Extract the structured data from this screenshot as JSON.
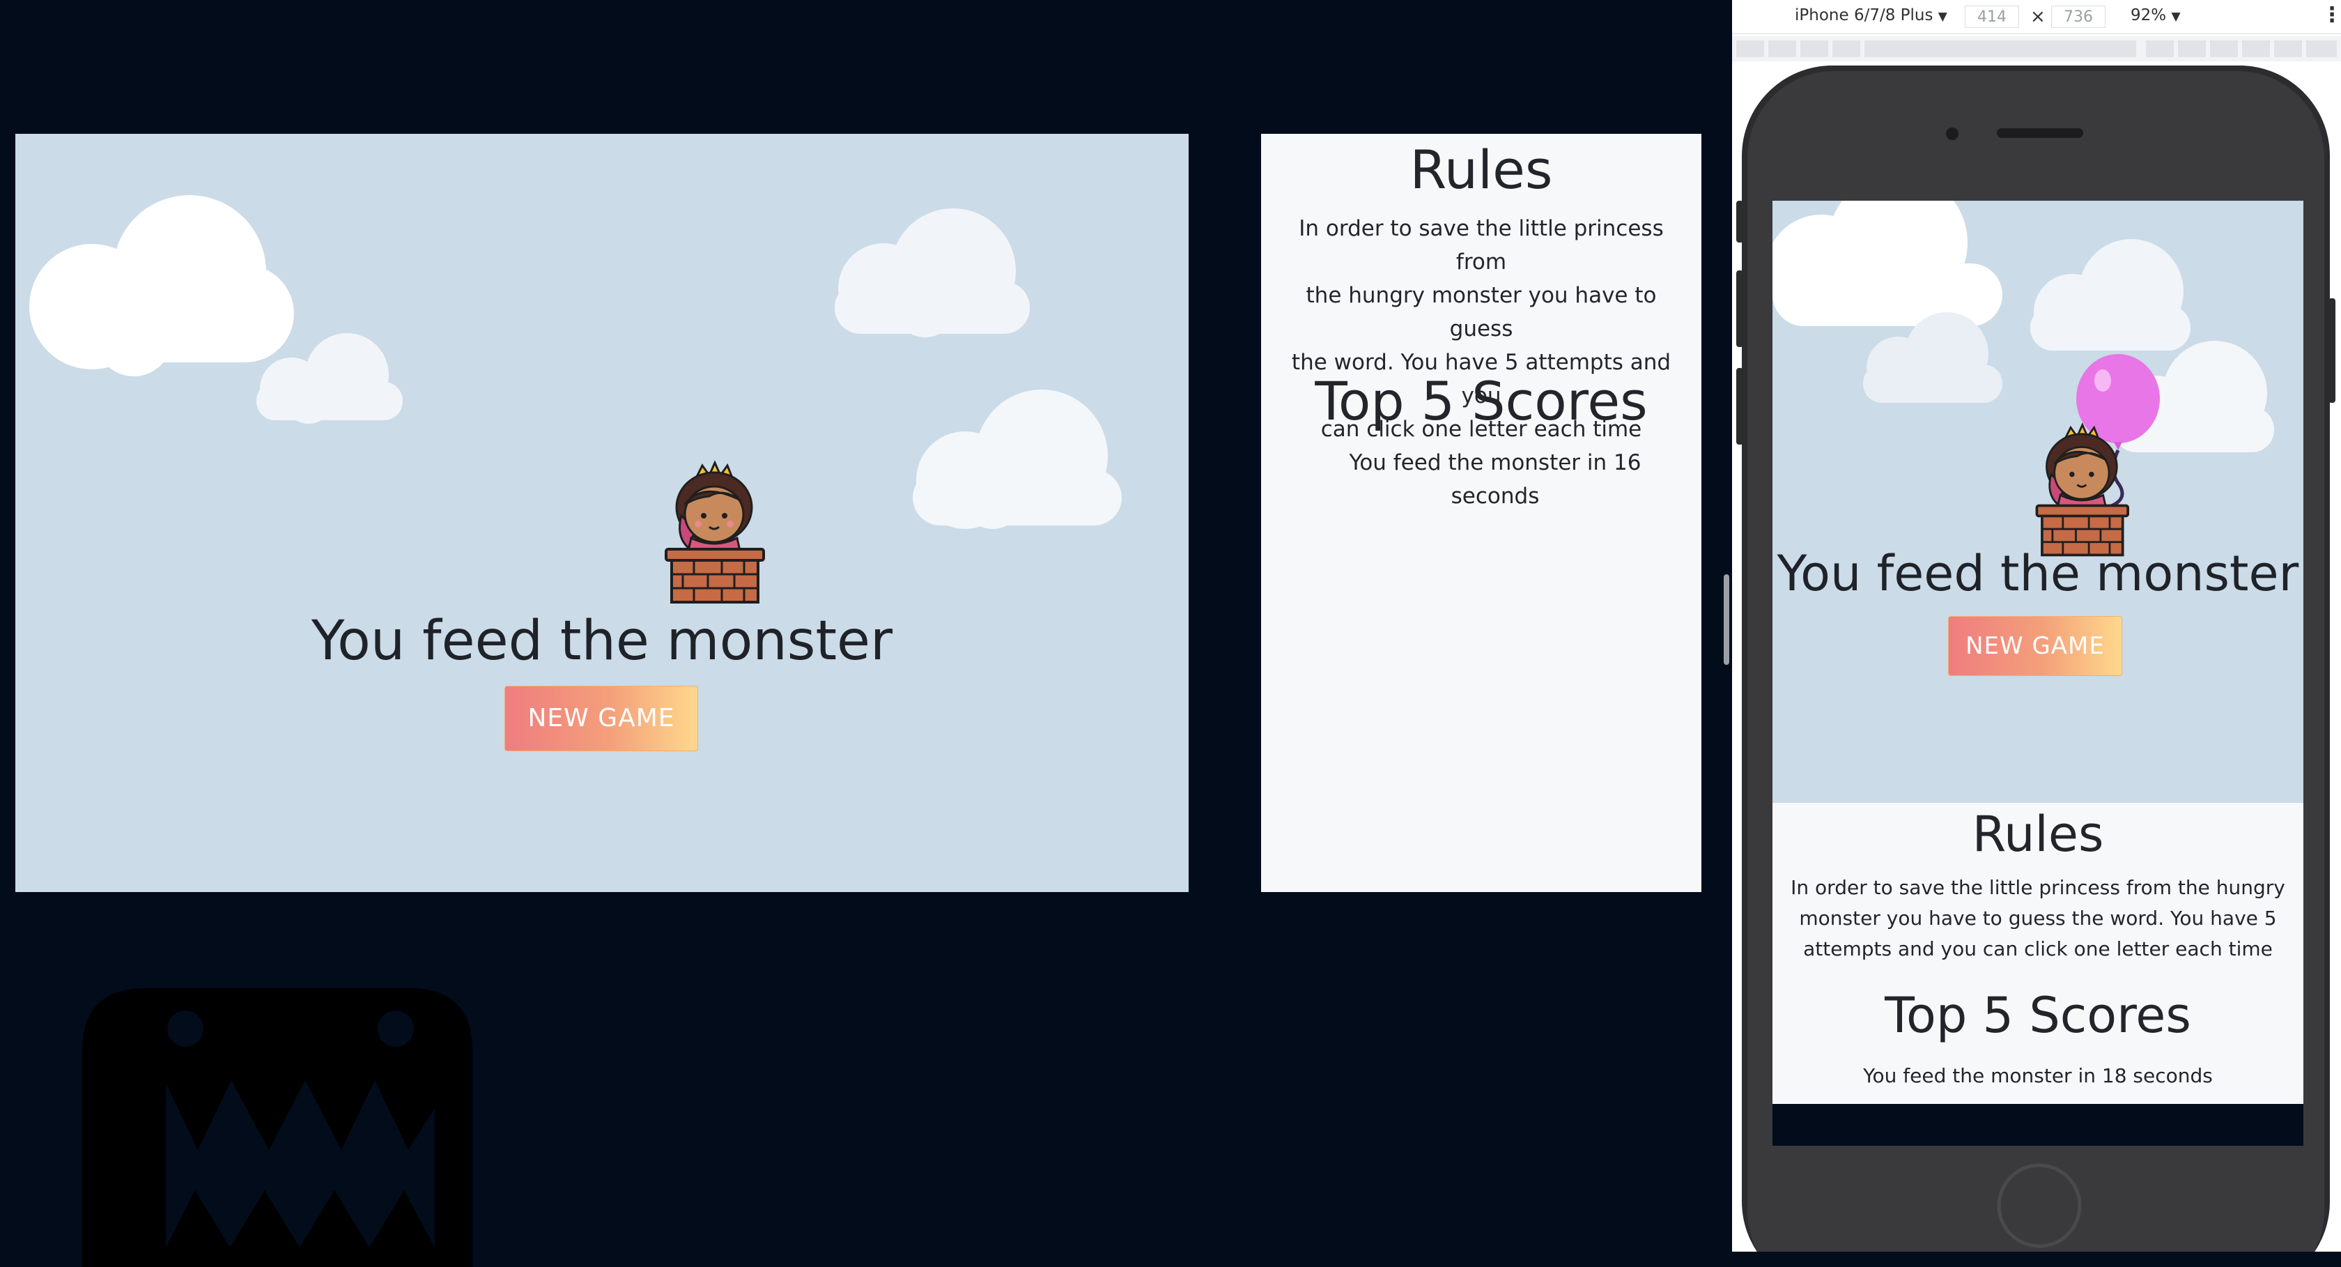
{
  "game": {
    "message": "You feed the monster",
    "new_game_label": "NEW GAME"
  },
  "rules": {
    "title": "Rules",
    "lines": [
      "In order to save the little princess from",
      "the hungry monster you have to guess",
      "the word. You have 5 attempts and you",
      "can click one letter each time"
    ],
    "scores_title": "Top 5 Scores",
    "score_lines": [
      "You feed the monster in 16",
      "seconds"
    ]
  },
  "devtools": {
    "device": "iPhone 6/7/8 Plus",
    "width": "414",
    "times": "×",
    "height": "736",
    "zoom": "92%",
    "dropdown_glyph": "▼",
    "more_glyph": "⋮"
  },
  "phone": {
    "message": "You feed the monster",
    "new_game_label": "NEW GAME",
    "rules_title": "Rules",
    "rules_lines": [
      "In order to save the little princess from the hungry",
      "monster you have to guess the word. You have 5",
      "attempts and you can click one letter each time"
    ],
    "scores_title": "Top 5 Scores",
    "score_line": "You feed the monster in 18 seconds"
  },
  "colors": {
    "page_bg": "#020c1b",
    "sky": "#cbdbe7",
    "panel": "#f7f8fa",
    "balloon": "#e876e6",
    "button_gradient": [
      "#ef7d7f",
      "#ffd88c"
    ]
  },
  "icons": [
    "princess-icon",
    "balloon-icon",
    "cloud-icon",
    "monster-silhouette-icon",
    "more-vertical-icon"
  ]
}
